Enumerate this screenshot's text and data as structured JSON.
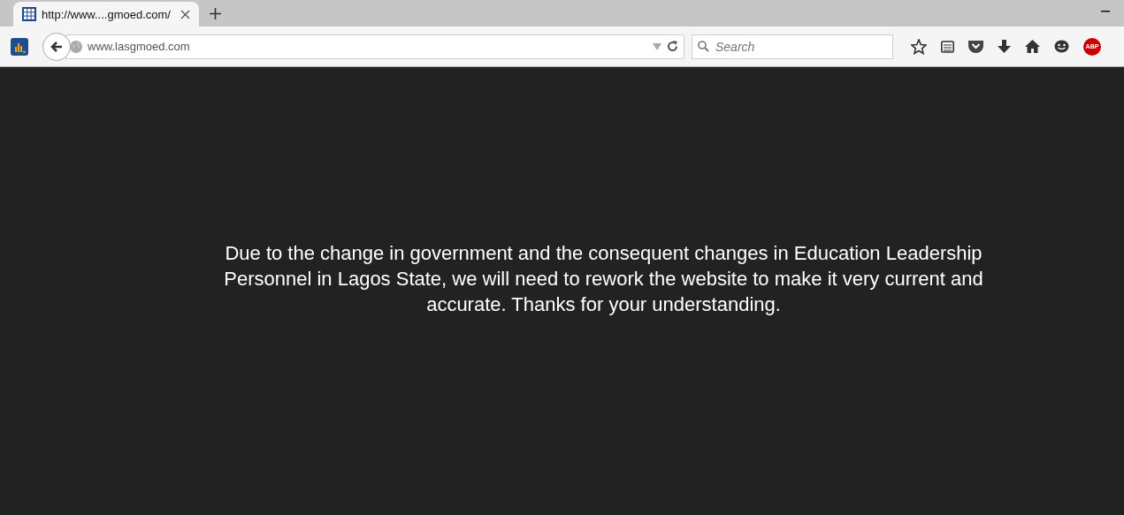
{
  "tab": {
    "title": "http://www....gmoed.com/",
    "selected": true
  },
  "address_bar": {
    "url": "www.lasgmoed.com"
  },
  "search": {
    "placeholder": "Search"
  },
  "adblock": {
    "label": "ABP"
  },
  "page": {
    "message": "Due to the change in government and the consequent changes in Education Leadership Personnel in Lagos State, we will need to rework the website to make it very current and accurate. Thanks for your understanding."
  }
}
